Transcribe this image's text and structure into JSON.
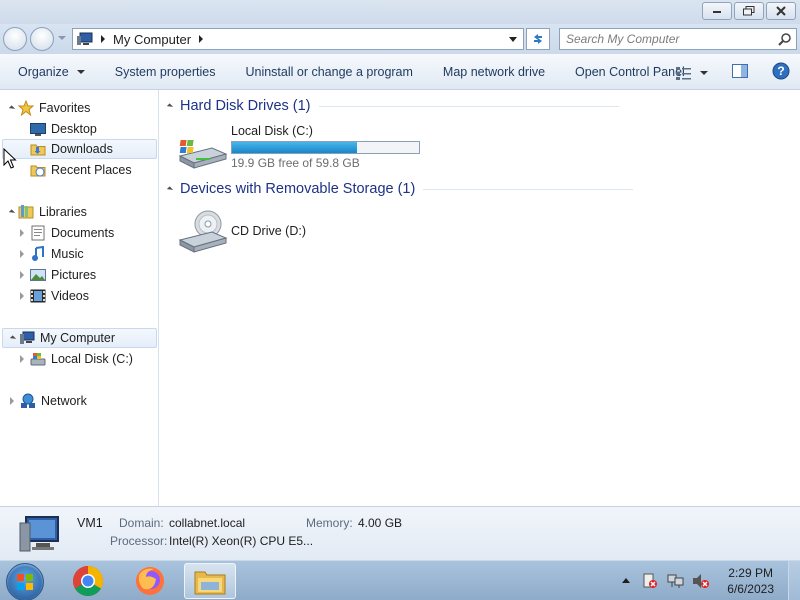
{
  "window": {
    "address_path": "My Computer",
    "search_placeholder": "Search My Computer"
  },
  "toolbar": {
    "organize": "Organize",
    "system_properties": "System properties",
    "uninstall": "Uninstall or change a program",
    "map_drive": "Map network drive",
    "control_panel": "Open Control Panel"
  },
  "nav": {
    "favorites": "Favorites",
    "desktop": "Desktop",
    "downloads": "Downloads",
    "recent": "Recent Places",
    "libraries": "Libraries",
    "documents": "Documents",
    "music": "Music",
    "pictures": "Pictures",
    "videos": "Videos",
    "computer": "My Computer",
    "local_disk": "Local Disk (C:)",
    "network": "Network"
  },
  "groups": {
    "hdd": "Hard Disk Drives (1)",
    "removable": "Devices with Removable Storage (1)"
  },
  "drives": {
    "c_name": "Local Disk (C:)",
    "c_free": "19.9 GB free of 59.8 GB",
    "c_used_fraction": 0.667,
    "d_name": "CD Drive (D:)"
  },
  "details": {
    "name": "VM1",
    "domain_label": "Domain:",
    "domain": "collabnet.local",
    "memory_label": "Memory:",
    "memory": "4.00 GB",
    "processor_label": "Processor:",
    "processor": "Intel(R) Xeon(R) CPU E5..."
  },
  "taskbar": {
    "time": "2:29 PM",
    "date": "6/6/2023"
  },
  "colors": {
    "accent": "#1e3287",
    "bar_fill": "#1a86c9"
  }
}
